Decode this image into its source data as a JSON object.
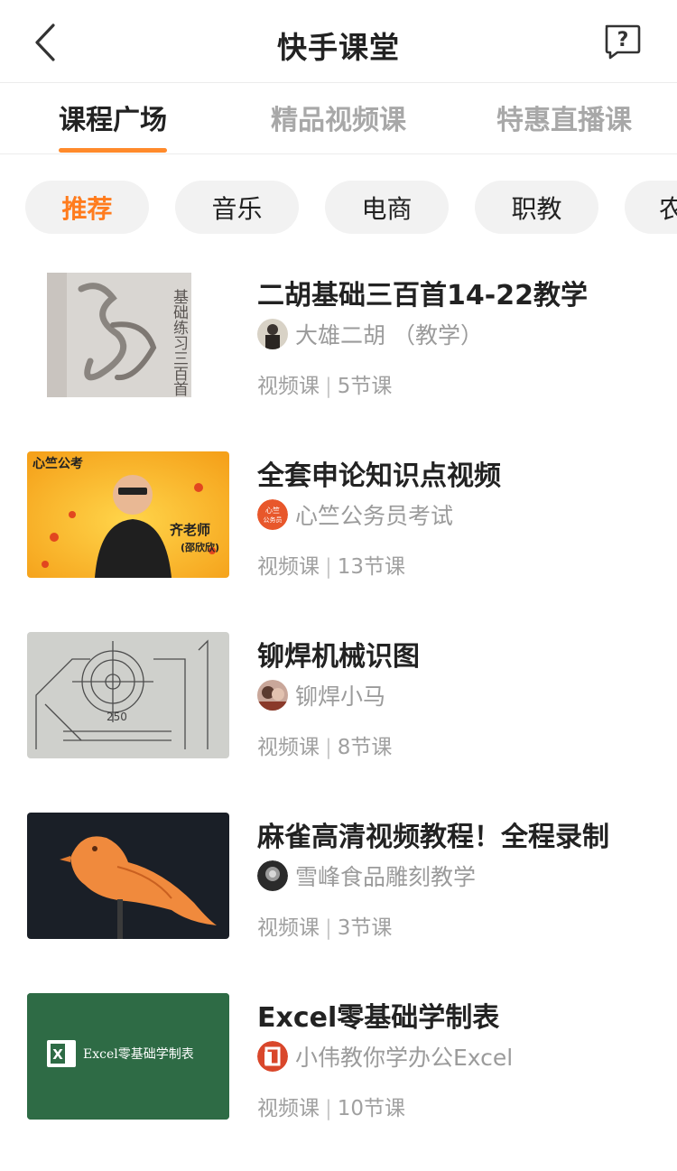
{
  "header": {
    "title": "快手课堂",
    "back_icon": "chevron-left-icon",
    "help_icon": "help-bubble-icon"
  },
  "tabs": [
    {
      "label": "课程广场",
      "active": true
    },
    {
      "label": "精品视频课",
      "active": false
    },
    {
      "label": "特惠直播课",
      "active": false
    }
  ],
  "categories": [
    {
      "label": "推荐",
      "active": true
    },
    {
      "label": "音乐",
      "active": false
    },
    {
      "label": "电商",
      "active": false
    },
    {
      "label": "职教",
      "active": false
    },
    {
      "label": "农",
      "active": false
    }
  ],
  "courses": [
    {
      "title": "二胡基础三百首14-22教学",
      "author": "大雄二胡 （教学）",
      "type": "视频课",
      "lessons": "5节课",
      "thumb_text": "基础练习三百首"
    },
    {
      "title": "全套申论知识点视频",
      "author": "心竺公务员考试",
      "type": "视频课",
      "lessons": "13节课",
      "thumb_text": "心竺公考",
      "thumb_teacher": "齐老师",
      "thumb_sub": "(邵欣欣)"
    },
    {
      "title": "铆焊机械识图",
      "author": "铆焊小马",
      "type": "视频课",
      "lessons": "8节课"
    },
    {
      "title": "麻雀高清视频教程！全程录制",
      "author": "雪峰食品雕刻教学",
      "type": "视频课",
      "lessons": "3节课"
    },
    {
      "title": "Excel零基础学制表",
      "author": "小伟教你学办公Excel",
      "type": "视频课",
      "lessons": "10节课",
      "thumb_text": "Excel零基础学制表"
    }
  ],
  "colors": {
    "accent": "#ff8a2b",
    "excel_green": "#2e6b45"
  }
}
